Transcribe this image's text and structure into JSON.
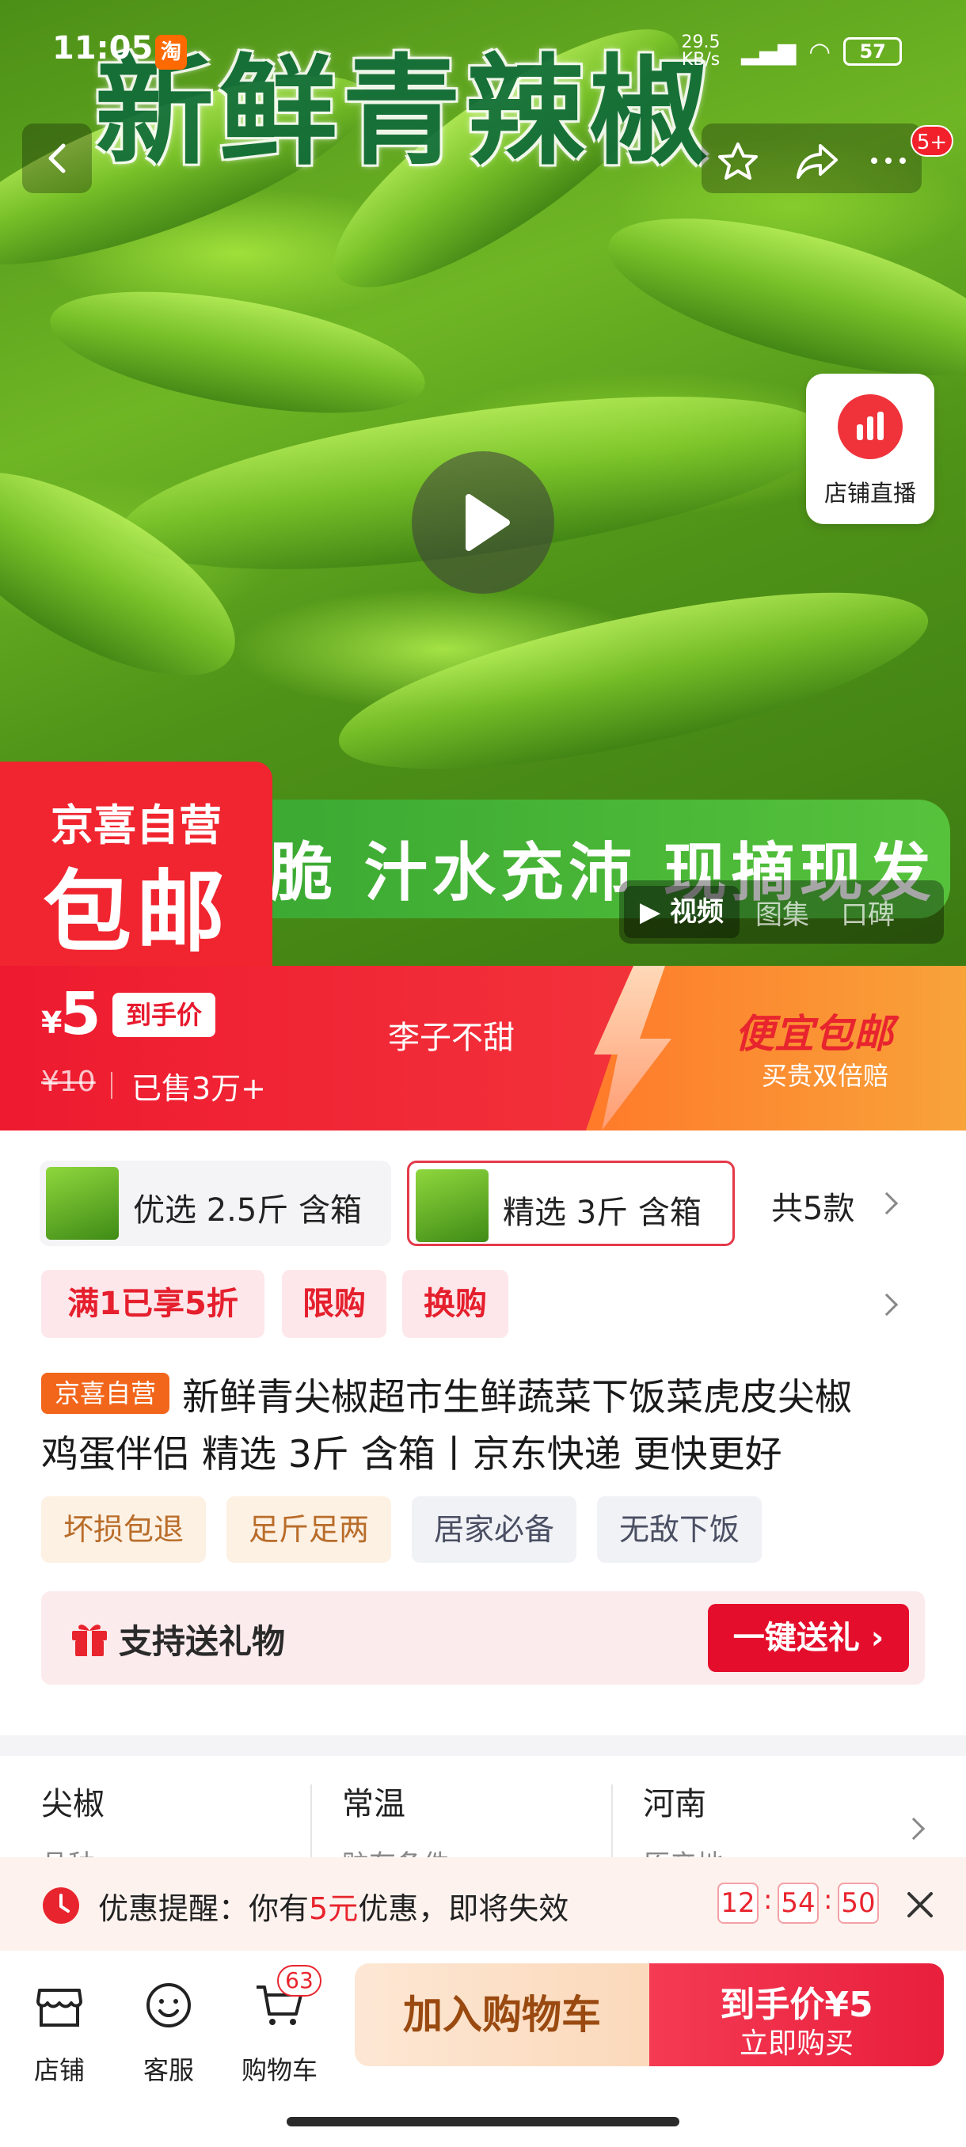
{
  "status": {
    "time": "11:05",
    "app_badge": "淘",
    "net_speed": "29.5 KB/s",
    "battery": "57"
  },
  "hero": {
    "title": "新鲜青辣椒",
    "banner": "脆 汁水充沛 现摘现发",
    "self_line1": "京喜自营",
    "self_line2": "包邮",
    "nav_badge": "5+",
    "live_label": "店铺直播",
    "media_tabs": [
      "视频",
      "图集",
      "口碑"
    ]
  },
  "price_bar": {
    "currency": "¥",
    "price": "5",
    "price_tag": "到手价",
    "original": "¥10",
    "sold": "已售3万+",
    "seller": "李子不甜",
    "promo_title": "便宜包邮",
    "promo_sub": "买贵双倍赔"
  },
  "variants": {
    "items": [
      {
        "label": "优选 2.5斤 含箱"
      },
      {
        "label": "精选 3斤 含箱"
      }
    ],
    "count_label": "共5款"
  },
  "coupons": [
    "满1已享5折",
    "限购",
    "换购"
  ],
  "product": {
    "self_tag": "京喜自营",
    "title_line1": "新鲜青尖椒超市生鲜蔬菜下饭菜虎皮尖椒",
    "title_line2": "鸡蛋伴侣 精选 3斤 含箱丨京东快递 更快更好",
    "tags": [
      "坏损包退",
      "足斤足两",
      "居家必备",
      "无敌下饭"
    ]
  },
  "gift": {
    "label": "支持送礼物",
    "button": "一键送礼 ›"
  },
  "attributes": [
    {
      "value": "尖椒",
      "key": "品种"
    },
    {
      "value": "常温",
      "key": "贮存条件"
    },
    {
      "value": "河南",
      "key": "原产地"
    }
  ],
  "reminder": {
    "prefix": "优惠提醒：你有",
    "amount": "5元",
    "suffix": "优惠，即将失效",
    "countdown": [
      "12",
      "54",
      "50"
    ]
  },
  "bottom": {
    "shop": "店铺",
    "service": "客服",
    "cart": "购物车",
    "cart_count": "63",
    "add_cart": "加入购物车",
    "buy_line1": "到手价¥5",
    "buy_line2": "立即购买"
  }
}
